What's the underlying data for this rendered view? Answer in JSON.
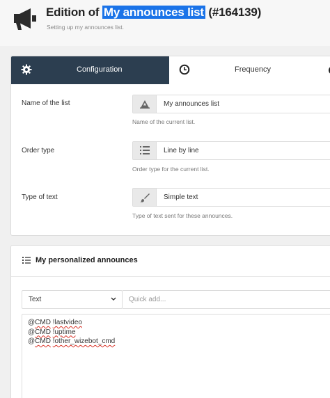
{
  "header": {
    "title_prefix": "Edition of",
    "title_highlight": "My announces list",
    "title_suffix": "(#164139)",
    "subtitle": "Setting up my announces list."
  },
  "tabs": [
    {
      "label": "Configuration",
      "icon": "gear-icon",
      "active": true
    },
    {
      "label": "Frequency",
      "icon": "clock-icon",
      "active": false
    }
  ],
  "config": {
    "name": {
      "label": "Name of the list",
      "value": "My announces list",
      "help": "Name of the current list.",
      "icon": "font-icon"
    },
    "order": {
      "label": "Order type",
      "value": "Line by line",
      "help": "Order type for the current list.",
      "icon": "list-icon"
    },
    "text_type": {
      "label": "Type of text",
      "value": "Simple text",
      "help": "Type of text sent for these announces.",
      "icon": "brush-icon"
    }
  },
  "announces": {
    "title": "My personalized announces",
    "select_value": "Text",
    "quick_add_placeholder": "Quick add...",
    "lines": [
      {
        "prefix": "@",
        "word1": "CMD",
        "sep": " ",
        "word2": "!lastvideo"
      },
      {
        "prefix": "@",
        "word1": "CMD",
        "sep": " ",
        "word2": "!uptime"
      },
      {
        "prefix": "@",
        "word1": "CMD",
        "sep": " ",
        "word2": "!other_wizebot_cmd"
      }
    ]
  },
  "colors": {
    "accent": "#1a73e8",
    "tab_active": "#2c3e50",
    "spellcheck": "#d93025"
  }
}
